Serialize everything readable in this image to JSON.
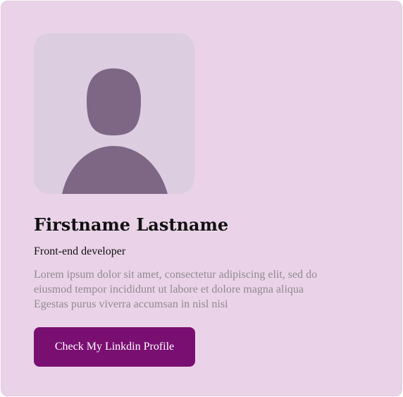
{
  "profile": {
    "name": "Firstname Lastname",
    "role": "Front-end developer",
    "description_lines": [
      "Lorem ipsum dolor sit amet, consectetur adipiscing elit, sed do",
      "eiusmod tempor incididunt ut labore et dolore magna aliqua",
      "Egestas purus viverra accumsan in nisl nisi"
    ],
    "avatar_icon": "person-silhouette-icon"
  },
  "cta": {
    "label": "Check My Linkdin Profile"
  },
  "colors": {
    "card_background": "#ead3e8",
    "avatar_background": "#dccde0",
    "avatar_figure": "#7e6785",
    "button_background": "#7a0f72",
    "button_text": "#ffffff",
    "description_text": "#908a90"
  }
}
